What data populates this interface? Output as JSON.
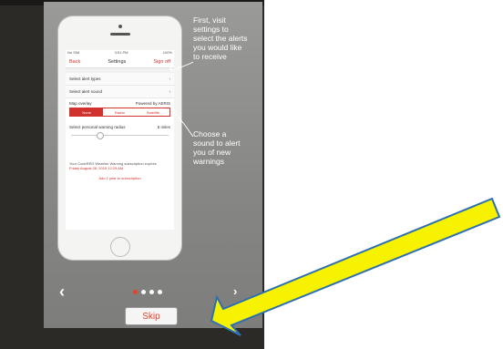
{
  "phone_screen": {
    "status": {
      "left": "No SIM",
      "time": "3:51 PM",
      "battery": "100%"
    },
    "nav": {
      "back": "Back",
      "title": "Settings",
      "signoff": "Sign off"
    },
    "rows": [
      "Select alert types",
      "Select alert sound"
    ],
    "map_overlay": {
      "label": "Map overlay",
      "powered_by": "Powered by AERIS",
      "options": [
        "None",
        "Radar",
        "Satellite"
      ],
      "selected": "None"
    },
    "radius": {
      "label": "Select personal warning radius",
      "value": "5 miles",
      "max": "25 miles"
    },
    "subscription": {
      "text": "Your CodeRED Weather Warning subscription expires",
      "expires": "Friday August 28, 2015 12:29 AM",
      "add_link": "Add 1 year to subscription"
    }
  },
  "annotations": {
    "first": "First, visit settings to select the alerts you would like to receive",
    "second": "Choose a sound to alert you of new warnings"
  },
  "carousel": {
    "page_count": 4,
    "current_page": 1
  },
  "controls": {
    "prev": "‹",
    "next": "›",
    "skip": "Skip"
  },
  "colors": {
    "accent_red": "#e5412c",
    "highlight_arrow": "#f6f200",
    "screen_gray": "#8a8a88",
    "case": "#2b2a27"
  }
}
